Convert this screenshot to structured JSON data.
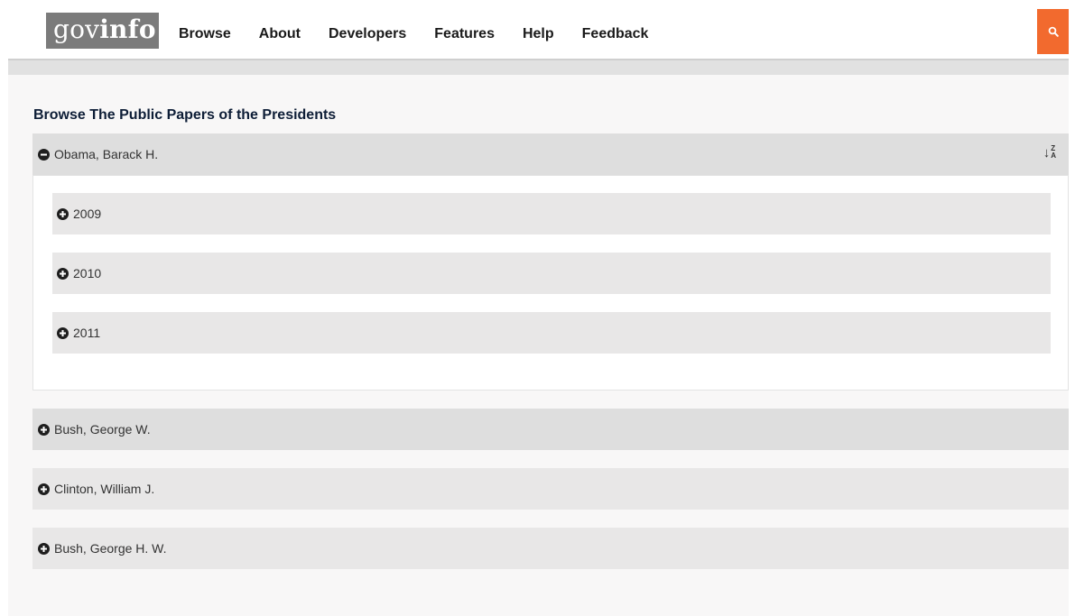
{
  "header": {
    "logo": {
      "part1": "gov",
      "part2": "info"
    },
    "nav": [
      "Browse",
      "About",
      "Developers",
      "Features",
      "Help",
      "Feedback"
    ],
    "search_icon": "search-icon",
    "accent_color": "#f26a2e"
  },
  "main": {
    "title": "Browse The Public Papers of the Presidents",
    "presidents": [
      {
        "label": "Obama, Barack H.",
        "expanded": true,
        "years": [
          "2009",
          "2010",
          "2011"
        ]
      },
      {
        "label": "Bush, George W.",
        "expanded": false
      },
      {
        "label": "Clinton, William J.",
        "expanded": false
      },
      {
        "label": "Bush, George H. W.",
        "expanded": false
      }
    ],
    "sort": {
      "icon": "sort-alpha-desc-icon",
      "top": "Z",
      "bottom": "A"
    }
  }
}
